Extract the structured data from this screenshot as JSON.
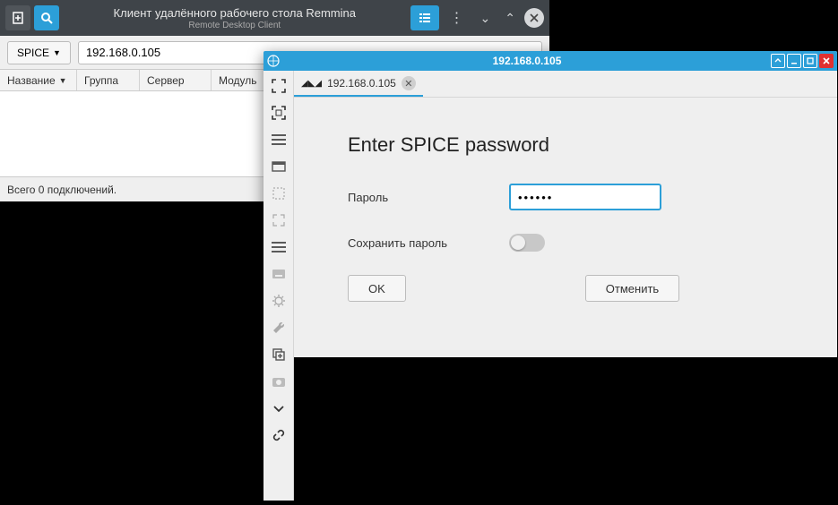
{
  "main_window": {
    "title": "Клиент удалённого рабочего стола Remmina",
    "subtitle": "Remote Desktop Client",
    "protocol_label": "SPICE",
    "address_value": "192.168.0.105",
    "columns": {
      "name": "Название",
      "group": "Группа",
      "server": "Сервер",
      "plugin": "Модуль"
    },
    "status": "Всего 0 подключений."
  },
  "conn_window": {
    "title": "192.168.0.105",
    "tab_label": "192.168.0.105",
    "login": {
      "heading": "Enter SPICE password",
      "password_label": "Пароль",
      "password_value": "••••••",
      "save_label": "Сохранить пароль",
      "ok_label": "OK",
      "cancel_label": "Отменить"
    }
  }
}
